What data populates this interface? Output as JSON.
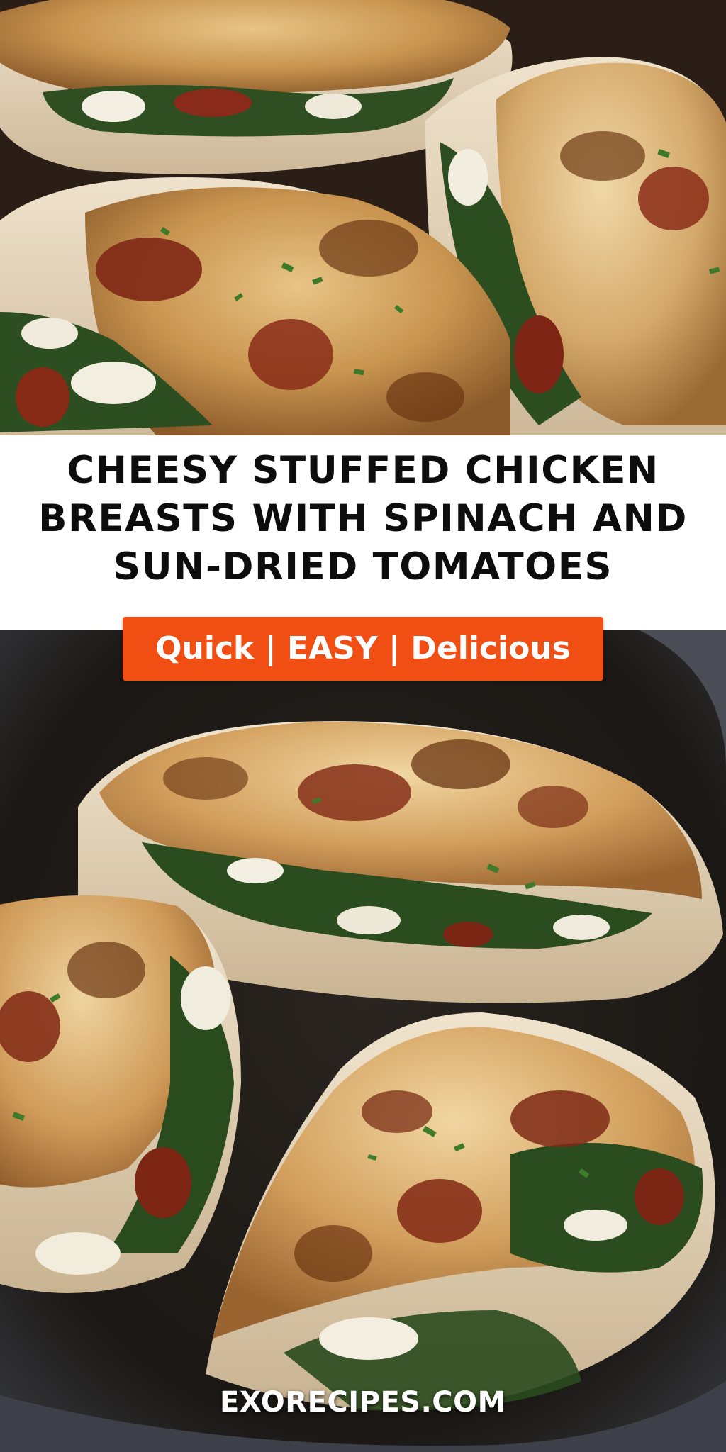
{
  "title": "CHEESY STUFFED CHICKEN BREASTS WITH SPINACH AND SUN-DRIED TOMATOES",
  "tagline": "Quick | EASY | Delicious",
  "website": "EXORECIPES.COM",
  "colors": {
    "accent": "#f04e12",
    "title_text": "#0d0d0d",
    "band_background": "#ffffff"
  }
}
